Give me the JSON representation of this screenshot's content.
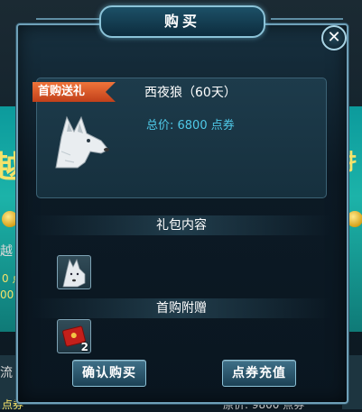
{
  "dialog": {
    "title": "购买",
    "close_symbol": "✕"
  },
  "offer": {
    "ribbon": "首购送礼",
    "item_name": "西夜狼（60天）",
    "price_label": "总价: 6800 点券"
  },
  "gift_content": {
    "heading": "礼包内容"
  },
  "first_purchase_bonus": {
    "heading": "首购附赠",
    "count": "2"
  },
  "buttons": {
    "confirm": "确认购买",
    "recharge": "点券充值"
  },
  "background": {
    "left_big": "越",
    "left_mid": "越",
    "left_small": "0 点",
    "left_small2": "00",
    "left_bottom": "流",
    "right_text": "扌",
    "right_bottom": "原价: 9800 点券",
    "left_bottom_small": "点券"
  }
}
